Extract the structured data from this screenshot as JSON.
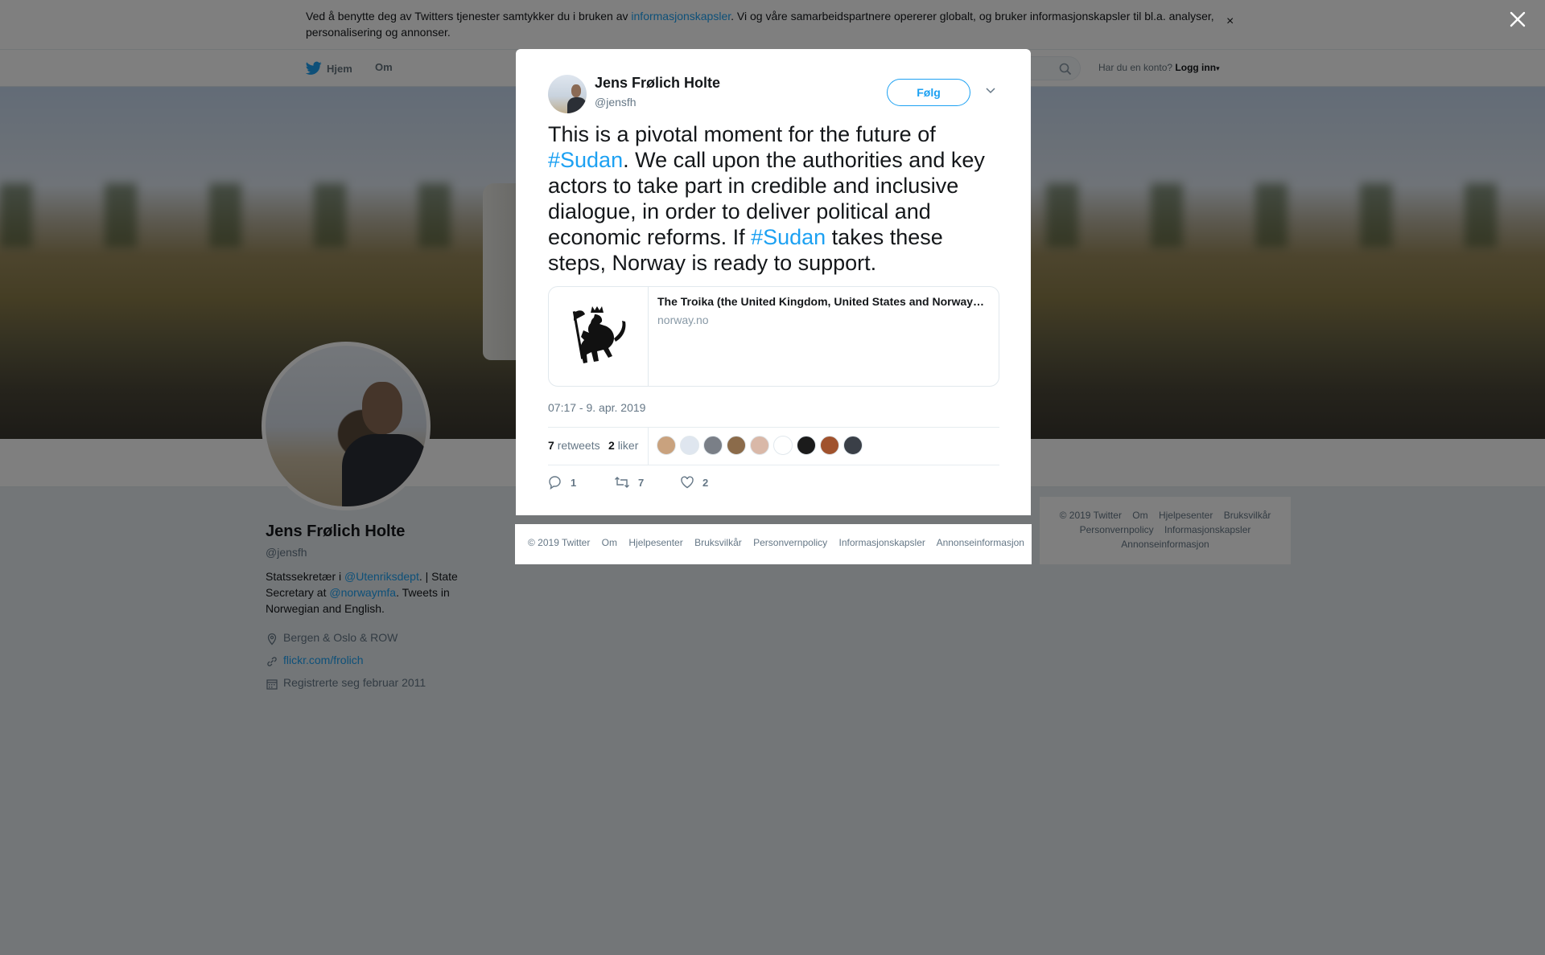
{
  "cookie_banner": {
    "text_before": "Ved å benytte deg av Twitters tjenester samtykker du i bruken av ",
    "link": "informasjonskapsler",
    "text_after": ". Vi og våre samarbeidspartnere opererer globalt, og bruker informasjonskapsler til bl.a. analyser, personalisering og annonser.",
    "close": "×"
  },
  "nav": {
    "home": "Hjem",
    "about": "Om",
    "login_prompt": "Har du en konto?",
    "login": "Logg inn"
  },
  "profile": {
    "name": "Jens Frølich Holte",
    "handle": "@jensfh",
    "bio_1": "Statssekretær i ",
    "bio_mention_1": "@Utenriksdept",
    "bio_2": ". | State Secretary at ",
    "bio_mention_2": "@norwaymfa",
    "bio_3": ". Tweets in Norwegian and English.",
    "location": "Bergen & Oslo & ROW",
    "website": "flickr.com/frolich",
    "joined": "Registrerte seg februar 2011"
  },
  "side_footer": {
    "items": [
      "© 2019 Twitter",
      "Om",
      "Hjelpesenter",
      "Bruksvilkår",
      "Personvernpolicy",
      "Informasjonskapsler",
      "Annonseinformasjon"
    ]
  },
  "tweet": {
    "author_name": "Jens Frølich Holte",
    "author_handle": "@jensfh",
    "follow_label": "Følg",
    "text_1": "This is a pivotal moment for the future of ",
    "hashtag_1": "#Sudan",
    "text_2": ". We call upon the authorities and key actors to take part in credible and inclusive dialogue, in order to deliver political and economic reforms. If ",
    "hashtag_2": "#Sudan",
    "text_3": " takes these steps, Norway is ready to support.",
    "card_title": "The Troika (the United Kingdom, United States and Norway) statement on Sudan",
    "card_domain": "norway.no",
    "timestamp": "07:17 - 9. apr. 2019",
    "retweets_count": "7",
    "retweets_label": "retweets",
    "likes_count": "2",
    "likes_label": "liker",
    "reply_count": "1",
    "retweet_action_count": "7",
    "like_action_count": "2",
    "liker_avatar_colors": [
      "#c9a27e",
      "#dfe6ef",
      "#7a7f87",
      "#8b6b4a",
      "#d9b8a8",
      "#ffffff",
      "#1b1b1b",
      "#a0522d",
      "#3a3f47"
    ]
  },
  "modal_footer": {
    "items": [
      "© 2019 Twitter",
      "Om",
      "Hjelpesenter",
      "Bruksvilkår",
      "Personvernpolicy",
      "Informasjonskapsler",
      "Annonseinformasjon"
    ]
  },
  "colors": {
    "accent": "#1da1f2",
    "overlay": "rgba(0,0,0,0.5)"
  }
}
